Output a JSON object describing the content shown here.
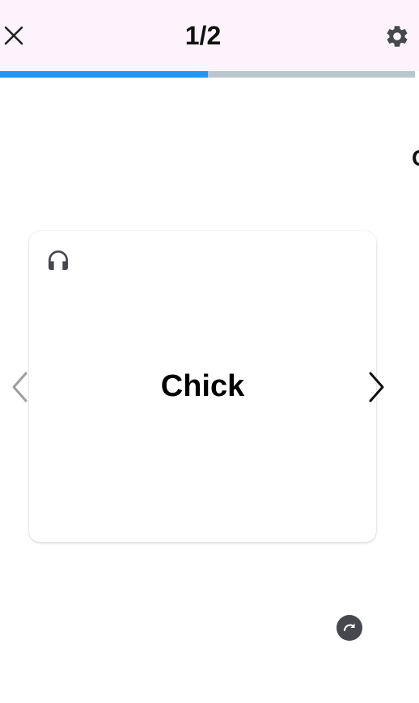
{
  "header": {
    "page_counter": "1/2",
    "close_icon": "close-icon",
    "settings_icon": "gear-icon"
  },
  "progress": {
    "fraction": 0.5,
    "fill_color": "#2196f3",
    "track_color": "#b9c6cc"
  },
  "card": {
    "word": "Chick",
    "audio_icon": "headphones-icon"
  },
  "peek_card": {
    "partial_text": "C"
  },
  "navigation": {
    "prev_icon": "chevron-left-icon",
    "next_icon": "chevron-right-icon"
  },
  "flip": {
    "icon": "redo-arrow-icon",
    "color": "#47474e"
  },
  "colors": {
    "header_bg": "#fdf3fc",
    "text": "#111111",
    "icon_dark": "#47474e",
    "icon_disabled": "#9e9e9e"
  }
}
